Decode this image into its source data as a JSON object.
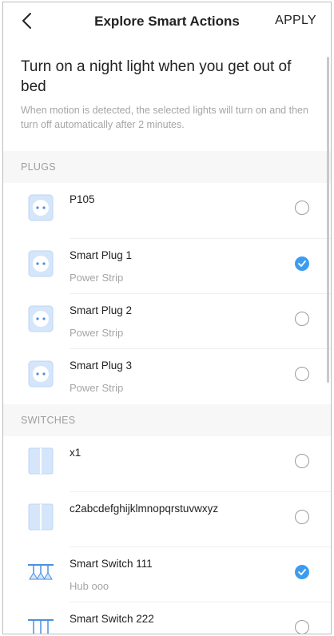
{
  "header": {
    "title": "Explore Smart Actions",
    "apply_label": "APPLY"
  },
  "intro": {
    "headline": "Turn on a night light when you get out of bed",
    "description": "When motion is detected, the selected lights will turn on and then turn off automatically after 2 minutes."
  },
  "sections": {
    "plugs": {
      "label": "PLUGS",
      "items": [
        {
          "name": "P105",
          "sub": "",
          "selected": false,
          "icon": "plug-icon"
        },
        {
          "name": "Smart Plug 1",
          "sub": "Power Strip",
          "selected": true,
          "icon": "plug-icon"
        },
        {
          "name": "Smart Plug 2",
          "sub": "Power Strip",
          "selected": false,
          "icon": "plug-icon"
        },
        {
          "name": "Smart Plug 3",
          "sub": "Power Strip",
          "selected": false,
          "icon": "plug-icon"
        }
      ]
    },
    "switches": {
      "label": "SWITCHES",
      "items": [
        {
          "name": "x1",
          "sub": "",
          "selected": false,
          "icon": "wall-switch-icon"
        },
        {
          "name": "c2abcdefghijklmnopqrstuvwxyz",
          "sub": "",
          "selected": false,
          "icon": "wall-switch-icon"
        },
        {
          "name": "Smart Switch 111",
          "sub": "Hub ooo",
          "selected": true,
          "icon": "ceiling-light-icon"
        },
        {
          "name": "Smart Switch 222",
          "sub": "",
          "selected": false,
          "icon": "ceiling-light-icon"
        }
      ]
    }
  },
  "colors": {
    "accent": "#3d9cf0",
    "icon_fill": "#d5e6fb",
    "icon_stroke": "#4a90e2"
  }
}
